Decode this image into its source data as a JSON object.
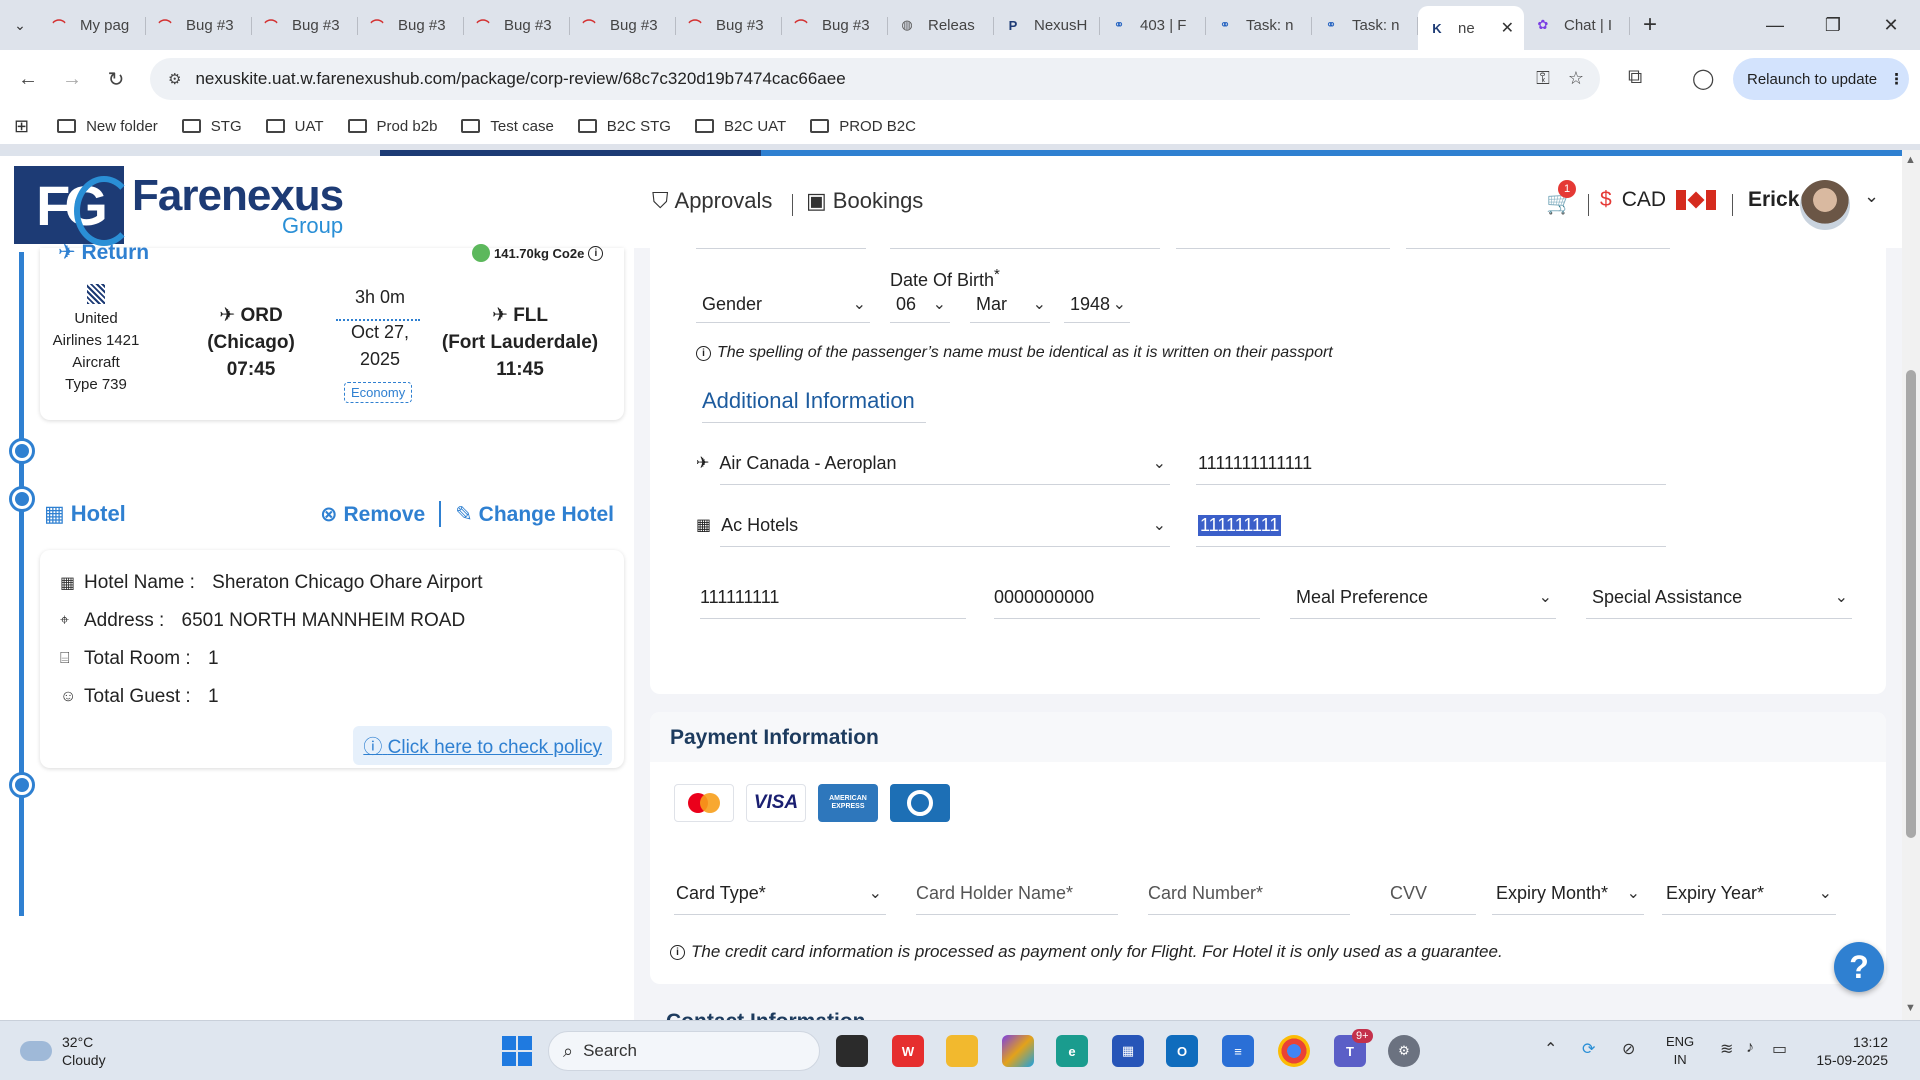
{
  "browser": {
    "tabs": [
      {
        "label": "My pag",
        "icon": "pagerduty-icon"
      },
      {
        "label": "Bug #3",
        "icon": "pagerduty-icon"
      },
      {
        "label": "Bug #3",
        "icon": "pagerduty-icon"
      },
      {
        "label": "Bug #3",
        "icon": "pagerduty-icon"
      },
      {
        "label": "Bug #3",
        "icon": "pagerduty-icon"
      },
      {
        "label": "Bug #3",
        "icon": "pagerduty-icon"
      },
      {
        "label": "Bug #3",
        "icon": "pagerduty-icon"
      },
      {
        "label": "Bug #3",
        "icon": "pagerduty-icon"
      },
      {
        "label": "Releas",
        "icon": "globe-icon"
      },
      {
        "label": "NexusH",
        "icon": "p-icon"
      },
      {
        "label": "403 | F",
        "icon": "link-icon"
      },
      {
        "label": "Task: n",
        "icon": "link-icon"
      },
      {
        "label": "Task: n",
        "icon": "link-icon"
      },
      {
        "label": "ne",
        "icon": "k-icon",
        "active": true
      },
      {
        "label": "Chat | I",
        "icon": "copilot-icon"
      }
    ],
    "url": "nexuskite.uat.w.farenexushub.com/package/corp-review/68c7c320d19b7474cac66aee",
    "relaunch_label": "Relaunch to update",
    "bookmarks": [
      "New folder",
      "STG",
      "UAT",
      "Prod b2b",
      "Test case",
      "B2C STG",
      "B2C UAT",
      "PROD B2C"
    ]
  },
  "logo": {
    "brand": "Farenexus",
    "sub": "Group",
    "mark": "FG"
  },
  "flight": {
    "section_label": "Return",
    "co2": "141.70kg Co2e",
    "airline_lines": [
      "United",
      "Airlines 1421",
      "Aircraft",
      "Type 739"
    ],
    "origin": {
      "code": "ORD",
      "city": "(Chicago)",
      "time": "07:45"
    },
    "duration": "3h 0m",
    "date_line1": "Oct 27,",
    "date_line2": "2025",
    "cabin": "Economy",
    "destination": {
      "code": "FLL",
      "city": "(Fort Lauderdale)",
      "time": "11:45"
    }
  },
  "hotel": {
    "title": "Hotel",
    "remove_label": "Remove",
    "change_label": "Change Hotel",
    "name_label": "Hotel Name :",
    "name_value": "Sheraton Chicago Ohare Airport",
    "address_label": "Address :",
    "address_value": "6501 NORTH MANNHEIM ROAD",
    "rooms_label": "Total Room :",
    "rooms_value": "1",
    "guests_label": "Total Guest :",
    "guests_value": "1",
    "policy_label": "Click here to check policy"
  },
  "header": {
    "approvals": "Approvals",
    "bookings": "Bookings",
    "cart_count": "1",
    "currency_symbol": "$",
    "currency": "CAD",
    "user": "Erick"
  },
  "passenger": {
    "gender_placeholder": "Gender",
    "dob_label": "Date Of Birth",
    "dob_required": "*",
    "dob_day": "06",
    "dob_month": "Mar",
    "dob_year": "1948",
    "name_notice": "The spelling of the passenger’s name must be identical as it is written on their passport",
    "additional_title": "Additional Information",
    "loyalty_airline": "Air Canada - Aeroplan",
    "loyalty_airline_number": "1111111111111",
    "loyalty_hotel": "Ac Hotels",
    "loyalty_hotel_number": "111111111",
    "field_a": "111111111",
    "field_b": "0000000000",
    "meal_placeholder": "Meal Preference",
    "assist_placeholder": "Special Assistance"
  },
  "payment": {
    "title": "Payment Information",
    "cards": [
      "mastercard-icon",
      "visa-icon",
      "amex-icon",
      "diners-icon"
    ],
    "visa_text": "VISA",
    "amex_text": "AMERICAN EXPRESS",
    "card_type_ph": "Card Type*",
    "holder_ph": "Card Holder Name*",
    "number_ph": "Card Number*",
    "cvv_ph": "CVV",
    "exp_month_ph": "Expiry Month*",
    "exp_year_ph": "Expiry Year*",
    "note": "The credit card information is processed as payment only for Flight. For Hotel it is only used as a guarantee."
  },
  "contact_peek": "Contact Information",
  "taskbar": {
    "temp": "32°C",
    "weather": "Cloudy",
    "search": "Search",
    "teams_badge": "9+",
    "lang1": "ENG",
    "lang2": "IN",
    "time": "13:12",
    "date": "15-09-2025"
  },
  "colors": {
    "accent": "#2f80d1",
    "brand": "#1d3b75",
    "selection": "#3b5fc9"
  }
}
